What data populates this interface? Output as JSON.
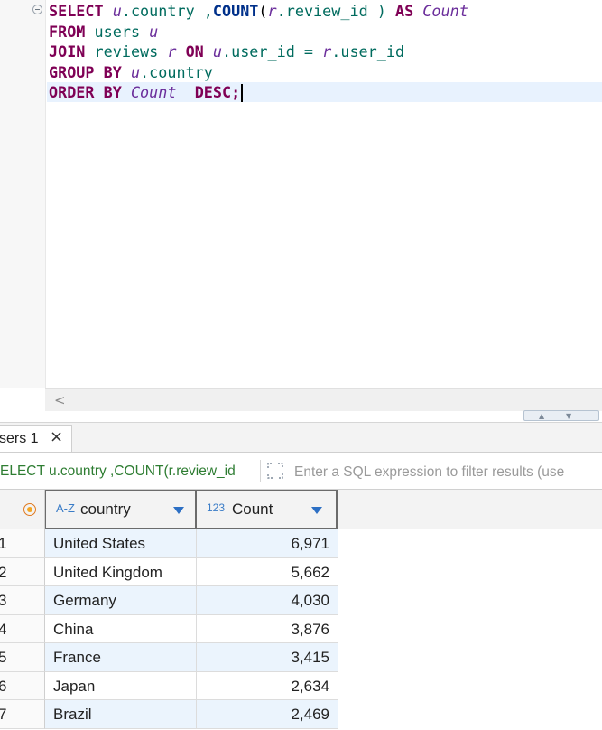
{
  "editor": {
    "lines": [
      [
        {
          "t": "SELECT ",
          "c": "kw"
        },
        {
          "t": "u",
          "c": "al"
        },
        {
          "t": ".country ,",
          "c": "pl"
        },
        {
          "t": "COUNT",
          "c": "fn"
        },
        {
          "t": "(",
          "c": "op"
        },
        {
          "t": "r",
          "c": "al"
        },
        {
          "t": ".review_id ) ",
          "c": "pl"
        },
        {
          "t": "AS ",
          "c": "kw"
        },
        {
          "t": "Count",
          "c": "al"
        }
      ],
      [
        {
          "t": "FROM ",
          "c": "kw"
        },
        {
          "t": "users ",
          "c": "pl"
        },
        {
          "t": "u",
          "c": "al"
        }
      ],
      [
        {
          "t": "JOIN ",
          "c": "kw"
        },
        {
          "t": "reviews ",
          "c": "pl"
        },
        {
          "t": "r ",
          "c": "al"
        },
        {
          "t": "ON ",
          "c": "kw"
        },
        {
          "t": "u",
          "c": "al"
        },
        {
          "t": ".user_id = ",
          "c": "pl"
        },
        {
          "t": "r",
          "c": "al"
        },
        {
          "t": ".user_id",
          "c": "pl"
        }
      ],
      [
        {
          "t": "GROUP BY ",
          "c": "kw"
        },
        {
          "t": "u",
          "c": "al"
        },
        {
          "t": ".country",
          "c": "pl"
        }
      ],
      [
        {
          "t": "ORDER BY ",
          "c": "kw"
        },
        {
          "t": "Count",
          "c": "al"
        },
        {
          "t": "  ",
          "c": "op"
        },
        {
          "t": "DESC;",
          "c": "kw"
        }
      ]
    ],
    "scroll_left_arrow": "<"
  },
  "results": {
    "tab_label": "sers 1",
    "tab_close": "×",
    "query_text": "ELECT u.country ,COUNT(r.review_id",
    "filter_placeholder": "Enter a SQL expression to filter results (use",
    "columns": [
      {
        "type_icon": "A-Z",
        "name": "country"
      },
      {
        "type_icon": "123",
        "name": "Count"
      }
    ],
    "rows": [
      {
        "num": "1",
        "country": "United States",
        "count": "6,971"
      },
      {
        "num": "2",
        "country": "United Kingdom",
        "count": "5,662"
      },
      {
        "num": "3",
        "country": "Germany",
        "count": "4,030"
      },
      {
        "num": "4",
        "country": "China",
        "count": "3,876"
      },
      {
        "num": "5",
        "country": "France",
        "count": "3,415"
      },
      {
        "num": "6",
        "country": "Japan",
        "count": "2,634"
      },
      {
        "num": "7",
        "country": "Brazil",
        "count": "2,469"
      }
    ]
  },
  "colors": {
    "keyword": "#7f0055",
    "function": "#00308a",
    "alias": "#6b2e9b",
    "plain": "#006b5e",
    "query_text": "#2e7d32",
    "row_highlight": "#ebf4fd",
    "current_line": "#e8f2fe"
  }
}
